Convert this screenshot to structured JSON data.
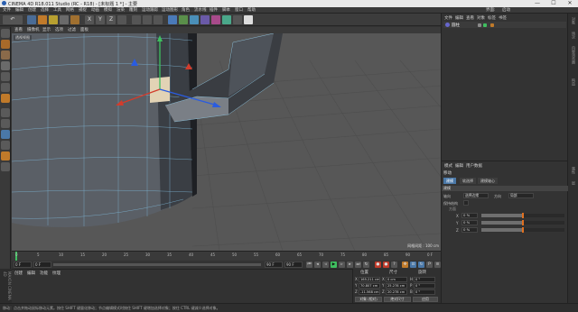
{
  "window": {
    "title": "CINEMA 4D R18.011 Studio (RC - R18) - [未标题 1 *] - 主要",
    "minimize": "—",
    "maximize": "☐",
    "close": "✕"
  },
  "menu": [
    "文件",
    "编辑",
    "创建",
    "选择",
    "工具",
    "网格",
    "捕捉",
    "动画",
    "模拟",
    "渲染",
    "雕刻",
    "运动跟踪",
    "运动图形",
    "角色",
    "流水线",
    "插件",
    "脚本",
    "窗口",
    "帮助",
    "界面:",
    "启动"
  ],
  "toolbar": {
    "undo": "↶",
    "x": "X",
    "y": "Y",
    "z": "Z"
  },
  "viewport": {
    "menu": [
      "查看",
      "摄像机",
      "显示",
      "选项",
      "过滤",
      "面板"
    ],
    "label": "透视视图",
    "grid_label": "网格间距 : 100 cm"
  },
  "timeline": {
    "ticks": [
      "0",
      "5",
      "10",
      "15",
      "20",
      "25",
      "30",
      "35",
      "40",
      "45",
      "50",
      "55",
      "60",
      "65",
      "70",
      "75",
      "80",
      "85",
      "90"
    ],
    "end_label": "0 F",
    "current_frame": "0 F",
    "start_field": "0 F",
    "end_field": "90 F",
    "end_field2": "90 F"
  },
  "materials": {
    "menu": [
      "创建",
      "编辑",
      "功能",
      "纹理"
    ],
    "side_label": "MAXON CINEMA 4D"
  },
  "coords": {
    "headers": [
      "位置",
      "尺寸",
      "旋转"
    ],
    "rows": [
      {
        "axis": "X",
        "pos": "165.211 cm",
        "size_axis": "X",
        "size": "0 cm",
        "rot_axis": "H",
        "rot": "0 °"
      },
      {
        "axis": "Y",
        "pos": "70.807 cm",
        "size_axis": "Y",
        "size": "25.278 cm",
        "rot_axis": "P",
        "rot": "0 °"
      },
      {
        "axis": "Z",
        "pos": "-11.568 cm",
        "size_axis": "Z",
        "size": "20.278 cm",
        "rot_axis": "B",
        "rot": "0 °"
      }
    ],
    "mode": "对象 (相对)",
    "size_mode": "绝对尺寸",
    "apply": "应用"
  },
  "status": "移动：点击并拖动鼠标移动元素。按住 SHIFT 键量化移动；节点编辑模式时按住 SHIFT 键增加选择对象；按住 CTRL 键减少选择对象。",
  "objects": {
    "menu": [
      "文件",
      "编辑",
      "查看",
      "对象",
      "标签",
      "书签"
    ],
    "item": "圆柱"
  },
  "attributes": {
    "menu": [
      "模式",
      "编辑",
      "用户数据"
    ],
    "header": "移动",
    "tabs": [
      "建模",
      "软选择",
      "建模轴心"
    ],
    "section": "建模",
    "rows": [
      {
        "label": "轴向",
        "value": "选择边缘",
        "label2": "方向",
        "value2": "局部"
      },
      {
        "label": "保持结构",
        "value": ""
      }
    ],
    "sub": "方面",
    "sliders": [
      {
        "label": "X",
        "value": "0 %",
        "level": 0.5
      },
      {
        "label": "Y",
        "value": "0 %",
        "level": 0.5
      },
      {
        "label": "Z",
        "value": "0 %",
        "level": 0.5
      }
    ]
  },
  "right_strip": [
    "对象",
    "场次",
    "内容浏览器",
    "构造",
    "属性",
    "层"
  ],
  "colors": {
    "viewport_bg": "#575757",
    "accent": "#4a78a8",
    "playhead": "#3fbf5f",
    "slider_knob": "#e07020"
  }
}
